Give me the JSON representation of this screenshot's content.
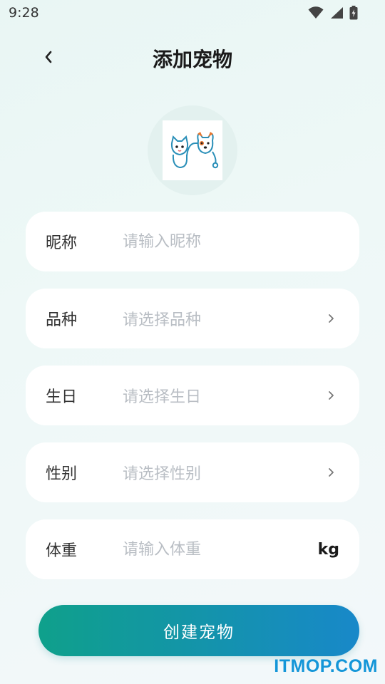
{
  "status_bar": {
    "time": "9:28",
    "icons": [
      "wifi-icon",
      "signal-icon",
      "battery-charging-icon"
    ]
  },
  "header": {
    "title": "添加宠物",
    "back_icon": "chevron-left-icon"
  },
  "avatar": {
    "icon": "pet-cat-dog-stethoscope-logo"
  },
  "form": {
    "nickname": {
      "label": "昵称",
      "placeholder": "请输入昵称"
    },
    "breed": {
      "label": "品种",
      "placeholder": "请选择品种"
    },
    "birthday": {
      "label": "生日",
      "placeholder": "请选择生日"
    },
    "gender": {
      "label": "性别",
      "placeholder": "请选择性别"
    },
    "weight": {
      "label": "体重",
      "placeholder": "请输入体重",
      "unit": "kg"
    }
  },
  "submit_label": "创建宠物",
  "watermark": "ITMOP.COM",
  "colors": {
    "button_gradient_start": "#0fa08b",
    "button_gradient_end": "#1888c9",
    "placeholder": "#b9bec4",
    "watermark": "#1496d8"
  }
}
